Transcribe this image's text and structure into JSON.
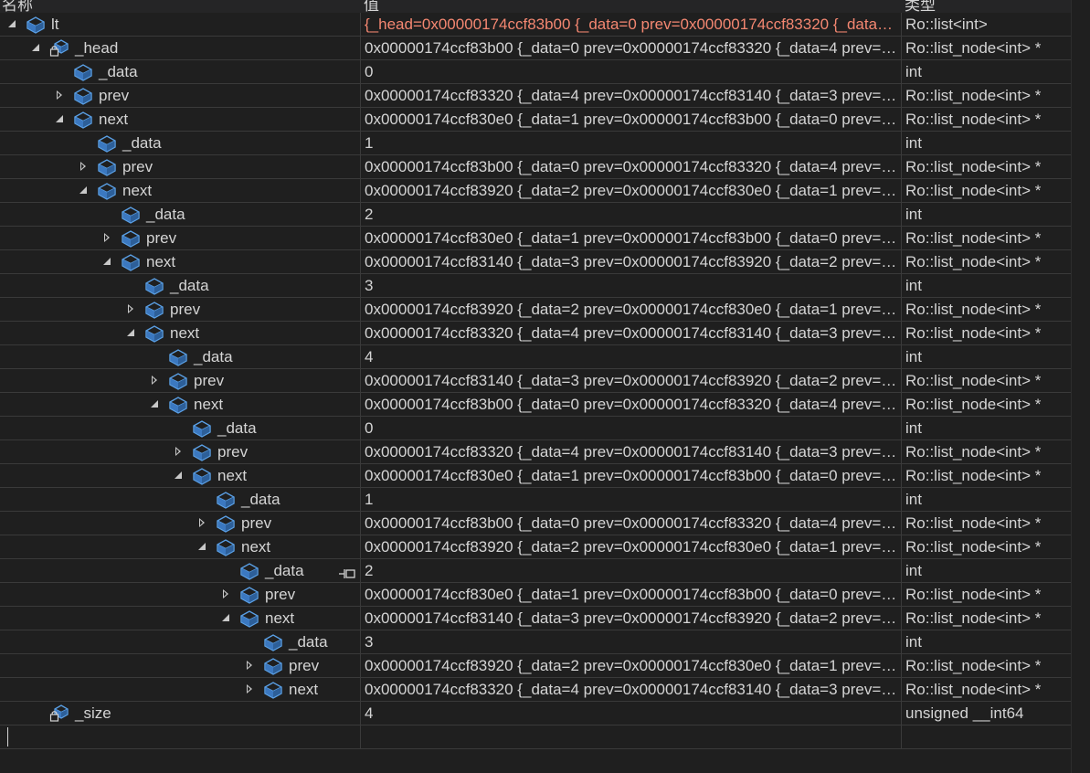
{
  "headers": {
    "name": "名称",
    "value": "值",
    "type": "类型"
  },
  "rows": [
    {
      "name": "lt",
      "value": "{_head=0x00000174ccf83b00 {_data=0 prev=0x00000174ccf83320 {_data=4 prev=0x00000174ccf83140 {_data=3 prev=...",
      "type": "Ro::list<int>",
      "depth": 0,
      "state": "expanded",
      "icon": "field-icon",
      "changed": true
    },
    {
      "name": "_head",
      "value": "0x00000174ccf83b00 {_data=0 prev=0x00000174ccf83320 {_data=4 prev=0x00000174ccf83140 {_data=3 prev=...",
      "type": "Ro::list_node<int> *",
      "depth": 1,
      "state": "expanded",
      "icon": "private-field-icon"
    },
    {
      "name": "_data",
      "value": "0",
      "type": "int",
      "depth": 2,
      "state": "none",
      "icon": "field-icon"
    },
    {
      "name": "prev",
      "value": "0x00000174ccf83320 {_data=4 prev=0x00000174ccf83140 {_data=3 prev=0x00000174ccf83920 {_data=2 prev=...",
      "type": "Ro::list_node<int> *",
      "depth": 2,
      "state": "collapsed",
      "icon": "field-icon"
    },
    {
      "name": "next",
      "value": "0x00000174ccf830e0 {_data=1 prev=0x00000174ccf83b00 {_data=0 prev=0x00000174ccf83320 {_data=4 prev=...",
      "type": "Ro::list_node<int> *",
      "depth": 2,
      "state": "expanded",
      "icon": "field-icon"
    },
    {
      "name": "_data",
      "value": "1",
      "type": "int",
      "depth": 3,
      "state": "none",
      "icon": "field-icon"
    },
    {
      "name": "prev",
      "value": "0x00000174ccf83b00 {_data=0 prev=0x00000174ccf83320 {_data=4 prev=0x00000174ccf83140 {_data=3 prev=...",
      "type": "Ro::list_node<int> *",
      "depth": 3,
      "state": "collapsed",
      "icon": "field-icon"
    },
    {
      "name": "next",
      "value": "0x00000174ccf83920 {_data=2 prev=0x00000174ccf830e0 {_data=1 prev=0x00000174ccf83b00 {_data=0 prev=...",
      "type": "Ro::list_node<int> *",
      "depth": 3,
      "state": "expanded",
      "icon": "field-icon"
    },
    {
      "name": "_data",
      "value": "2",
      "type": "int",
      "depth": 4,
      "state": "none",
      "icon": "field-icon"
    },
    {
      "name": "prev",
      "value": "0x00000174ccf830e0 {_data=1 prev=0x00000174ccf83b00 {_data=0 prev=0x00000174ccf83320 {_data=4 prev=...",
      "type": "Ro::list_node<int> *",
      "depth": 4,
      "state": "collapsed",
      "icon": "field-icon"
    },
    {
      "name": "next",
      "value": "0x00000174ccf83140 {_data=3 prev=0x00000174ccf83920 {_data=2 prev=0x00000174ccf830e0 {_data=1 prev=...",
      "type": "Ro::list_node<int> *",
      "depth": 4,
      "state": "expanded",
      "icon": "field-icon"
    },
    {
      "name": "_data",
      "value": "3",
      "type": "int",
      "depth": 5,
      "state": "none",
      "icon": "field-icon"
    },
    {
      "name": "prev",
      "value": "0x00000174ccf83920 {_data=2 prev=0x00000174ccf830e0 {_data=1 prev=0x00000174ccf83b00 {_data=0 prev=...",
      "type": "Ro::list_node<int> *",
      "depth": 5,
      "state": "collapsed",
      "icon": "field-icon"
    },
    {
      "name": "next",
      "value": "0x00000174ccf83320 {_data=4 prev=0x00000174ccf83140 {_data=3 prev=0x00000174ccf83920 {_data=2 prev=...",
      "type": "Ro::list_node<int> *",
      "depth": 5,
      "state": "expanded",
      "icon": "field-icon"
    },
    {
      "name": "_data",
      "value": "4",
      "type": "int",
      "depth": 6,
      "state": "none",
      "icon": "field-icon"
    },
    {
      "name": "prev",
      "value": "0x00000174ccf83140 {_data=3 prev=0x00000174ccf83920 {_data=2 prev=0x00000174ccf830e0 {_data=1 prev=...",
      "type": "Ro::list_node<int> *",
      "depth": 6,
      "state": "collapsed",
      "icon": "field-icon"
    },
    {
      "name": "next",
      "value": "0x00000174ccf83b00 {_data=0 prev=0x00000174ccf83320 {_data=4 prev=0x00000174ccf83140 {_data=3 prev=...",
      "type": "Ro::list_node<int> *",
      "depth": 6,
      "state": "expanded",
      "icon": "field-icon"
    },
    {
      "name": "_data",
      "value": "0",
      "type": "int",
      "depth": 7,
      "state": "none",
      "icon": "field-icon"
    },
    {
      "name": "prev",
      "value": "0x00000174ccf83320 {_data=4 prev=0x00000174ccf83140 {_data=3 prev=0x00000174ccf83920 {_data=2 prev=...",
      "type": "Ro::list_node<int> *",
      "depth": 7,
      "state": "collapsed",
      "icon": "field-icon"
    },
    {
      "name": "next",
      "value": "0x00000174ccf830e0 {_data=1 prev=0x00000174ccf83b00 {_data=0 prev=0x00000174ccf83320 {_data=4 prev=...",
      "type": "Ro::list_node<int> *",
      "depth": 7,
      "state": "expanded",
      "icon": "field-icon"
    },
    {
      "name": "_data",
      "value": "1",
      "type": "int",
      "depth": 8,
      "state": "none",
      "icon": "field-icon"
    },
    {
      "name": "prev",
      "value": "0x00000174ccf83b00 {_data=0 prev=0x00000174ccf83320 {_data=4 prev=0x00000174ccf83140 {_data=3 prev=...",
      "type": "Ro::list_node<int> *",
      "depth": 8,
      "state": "collapsed",
      "icon": "field-icon"
    },
    {
      "name": "next",
      "value": "0x00000174ccf83920 {_data=2 prev=0x00000174ccf830e0 {_data=1 prev=0x00000174ccf83b00 {_data=0 prev=...",
      "type": "Ro::list_node<int> *",
      "depth": 8,
      "state": "expanded",
      "icon": "field-icon"
    },
    {
      "name": "_data",
      "value": "2",
      "type": "int",
      "depth": 9,
      "state": "none",
      "icon": "field-icon",
      "pin": true
    },
    {
      "name": "prev",
      "value": "0x00000174ccf830e0 {_data=1 prev=0x00000174ccf83b00 {_data=0 prev=0x00000174ccf83320 {_data=4 prev=...",
      "type": "Ro::list_node<int> *",
      "depth": 9,
      "state": "collapsed",
      "icon": "field-icon"
    },
    {
      "name": "next",
      "value": "0x00000174ccf83140 {_data=3 prev=0x00000174ccf83920 {_data=2 prev=0x00000174ccf830e0 {_data=1 prev=...",
      "type": "Ro::list_node<int> *",
      "depth": 9,
      "state": "expanded",
      "icon": "field-icon"
    },
    {
      "name": "_data",
      "value": "3",
      "type": "int",
      "depth": 10,
      "state": "none",
      "icon": "field-icon"
    },
    {
      "name": "prev",
      "value": "0x00000174ccf83920 {_data=2 prev=0x00000174ccf830e0 {_data=1 prev=0x00000174ccf83b00 {_data=0 prev=...",
      "type": "Ro::list_node<int> *",
      "depth": 10,
      "state": "collapsed",
      "icon": "field-icon"
    },
    {
      "name": "next",
      "value": "0x00000174ccf83320 {_data=4 prev=0x00000174ccf83140 {_data=3 prev=0x00000174ccf83920 {_data=2 prev=...",
      "type": "Ro::list_node<int> *",
      "depth": 10,
      "state": "collapsed",
      "icon": "field-icon"
    },
    {
      "name": "_size",
      "value": "4",
      "type": "unsigned __int64",
      "depth": 1,
      "state": "none",
      "icon": "private-field-icon"
    }
  ],
  "colors": {
    "background": "#1f1f1f",
    "text": "#d4d4d4",
    "changed_value": "#f48771",
    "grid": "#3a3a3a",
    "icon_blue": "#4f8fd6"
  }
}
